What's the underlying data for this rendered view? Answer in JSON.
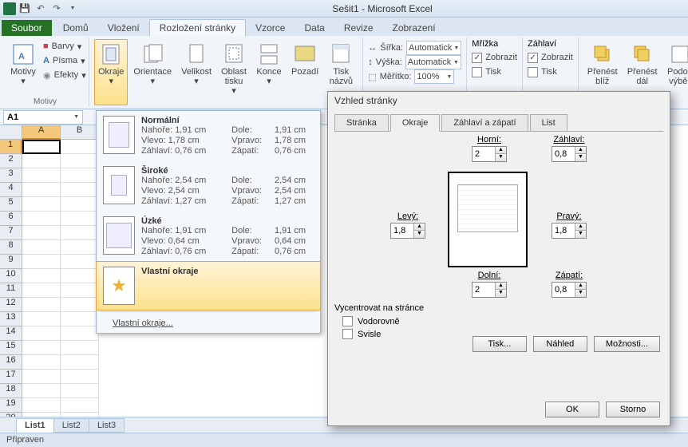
{
  "title": "Sešit1 - Microsoft Excel",
  "tabs": {
    "file": "Soubor",
    "home": "Domů",
    "insert": "Vložení",
    "pageLayout": "Rozložení stránky",
    "formulas": "Vzorce",
    "data": "Data",
    "review": "Revize",
    "view": "Zobrazení"
  },
  "ribbon": {
    "themes": {
      "label": "Motivy",
      "motivy": "Motivy",
      "barvy": "Barvy",
      "pisma": "Písma",
      "efekty": "Efekty"
    },
    "pageSetup": {
      "okraje": "Okraje",
      "orientace": "Orientace",
      "velikost": "Velikost",
      "oblast": "Oblast tisku",
      "konce": "Konce",
      "pozadi": "Pozadí",
      "tisk": "Tisk názvů"
    },
    "scale": {
      "sirka": "Šířka:",
      "vyska": "Výška:",
      "meritko": "Měřítko:",
      "auto": "Automatick",
      "pct": "100%"
    },
    "gridlines": {
      "mrizka": "Mřížka",
      "zobrazit": "Zobrazit",
      "tisk": "Tisk"
    },
    "headings": {
      "zahlavi": "Záhlaví",
      "zobrazit": "Zobrazit",
      "tisk": "Tisk"
    },
    "arrange": {
      "prenest_bliz": "Přenést blíž",
      "prenest_dal": "Přenést dál",
      "podok": "Podok výběr"
    }
  },
  "namebox": "A1",
  "columns": [
    "A",
    "B"
  ],
  "sheetTabs": [
    "List1",
    "List2",
    "List3"
  ],
  "statusbar": "Připraven",
  "marginsMenu": {
    "normal": {
      "title": "Normální",
      "nahore": "Nahoře: 1,91 cm",
      "dole": "Dole:",
      "dole_v": "1,91 cm",
      "vlevo": "Vlevo:  1,78 cm",
      "vpravo": "Vpravo:",
      "vpravo_v": "1,78 cm",
      "zahlavi": "Záhlaví: 0,76 cm",
      "zapati": "Zápatí:",
      "zapati_v": "0,76 cm"
    },
    "wide": {
      "title": "Široké",
      "nahore": "Nahoře: 2,54 cm",
      "dole": "Dole:",
      "dole_v": "2,54 cm",
      "vlevo": "Vlevo:  2,54 cm",
      "vpravo": "Vpravo:",
      "vpravo_v": "2,54 cm",
      "zahlavi": "Záhlaví: 1,27 cm",
      "zapati": "Zápatí:",
      "zapati_v": "1,27 cm"
    },
    "narrow": {
      "title": "Úzké",
      "nahore": "Nahoře: 1,91 cm",
      "dole": "Dole:",
      "dole_v": "1,91 cm",
      "vlevo": "Vlevo:  0,64 cm",
      "vpravo": "Vpravo:",
      "vpravo_v": "0,64 cm",
      "zahlavi": "Záhlaví: 0,76 cm",
      "zapati": "Zápatí:",
      "zapati_v": "0,76 cm"
    },
    "custom": "Vlastní okraje",
    "customLink": "Vlastní okraje..."
  },
  "dialog": {
    "title": "Vzhled stránky",
    "tabs": {
      "stranka": "Stránka",
      "okraje": "Okraje",
      "zahlavi": "Záhlaví a zápatí",
      "list": "List"
    },
    "horni": {
      "label": "Horní:",
      "val": "2"
    },
    "zahlaviTop": {
      "label": "Záhlaví:",
      "val": "0,8"
    },
    "levy": {
      "label": "Levý:",
      "val": "1,8"
    },
    "pravy": {
      "label": "Pravý:",
      "val": "1,8"
    },
    "dolni": {
      "label": "Dolní:",
      "val": "2"
    },
    "zapati": {
      "label": "Zápatí:",
      "val": "0,8"
    },
    "centerTitle": "Vycentrovat na stránce",
    "vodorovne": "Vodorovně",
    "svisle": "Svisle",
    "btns": {
      "tisk": "Tisk...",
      "nahled": "Náhled",
      "moznosti": "Možnosti...",
      "ok": "OK",
      "storno": "Storno"
    }
  }
}
